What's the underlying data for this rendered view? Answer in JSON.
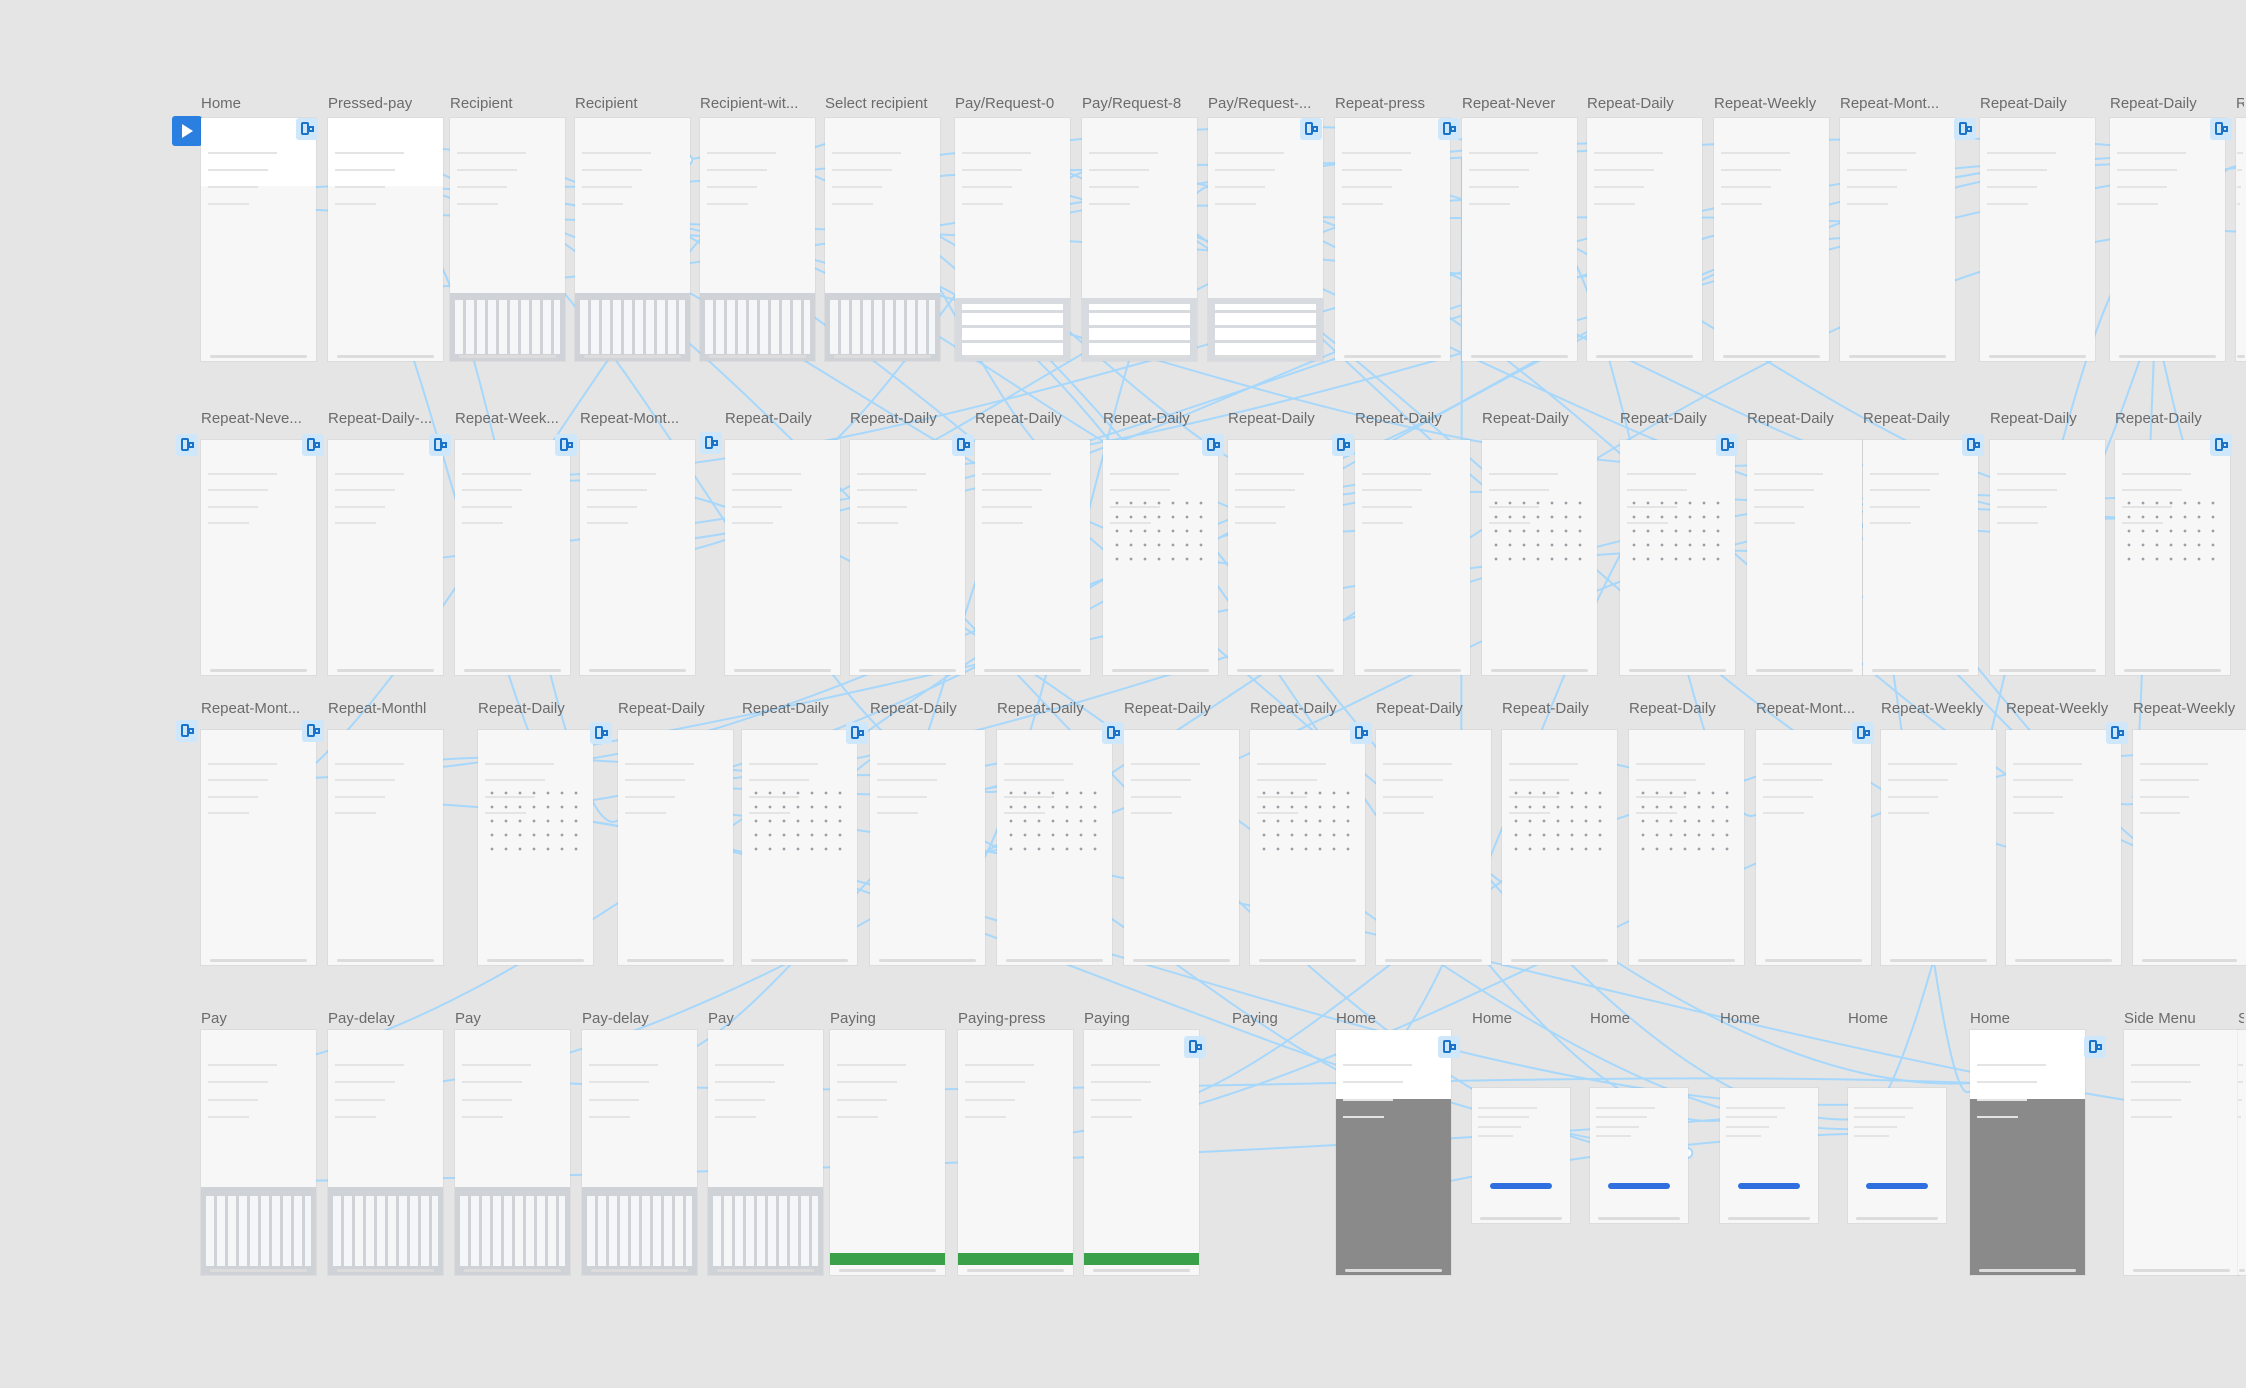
{
  "canvas": {
    "background": "#e5e5e5",
    "accent": "#2a7fe0",
    "wire_color": "#a7d8fb"
  },
  "rows": [
    {
      "frames": [
        {
          "label": "Home",
          "kind": "home"
        },
        {
          "label": "Pressed-pay",
          "kind": "home"
        },
        {
          "label": "Recipient",
          "kind": "list"
        },
        {
          "label": "Recipient",
          "kind": "list"
        },
        {
          "label": "Recipient-wit...",
          "kind": "list"
        },
        {
          "label": "Select recipient",
          "kind": "list"
        },
        {
          "label": "Pay/Request-0",
          "kind": "pad"
        },
        {
          "label": "Pay/Request-8",
          "kind": "pad"
        },
        {
          "label": "Pay/Request-...",
          "kind": "pad"
        },
        {
          "label": "Repeat-press",
          "kind": "plain"
        },
        {
          "label": "Repeat-Never",
          "kind": "plain"
        },
        {
          "label": "Repeat-Daily",
          "kind": "plain"
        },
        {
          "label": "Repeat-Weekly",
          "kind": "plain"
        },
        {
          "label": "Repeat-Mont...",
          "kind": "plain"
        },
        {
          "label": "Repeat-Daily",
          "kind": "plain"
        },
        {
          "label": "Repeat-Daily",
          "kind": "plain"
        },
        {
          "label": "R",
          "kind": "plain"
        }
      ]
    },
    {
      "frames": [
        {
          "label": "Repeat-Neve...",
          "kind": "plain"
        },
        {
          "label": "Repeat-Daily-...",
          "kind": "plain"
        },
        {
          "label": "Repeat-Week...",
          "kind": "plain"
        },
        {
          "label": "Repeat-Mont...",
          "kind": "plain"
        },
        {
          "label": "Repeat-Daily",
          "kind": "plain"
        },
        {
          "label": "Repeat-Daily",
          "kind": "plain"
        },
        {
          "label": "Repeat-Daily",
          "kind": "plain"
        },
        {
          "label": "Repeat-Daily",
          "kind": "cal"
        },
        {
          "label": "Repeat-Daily",
          "kind": "plain"
        },
        {
          "label": "Repeat-Daily",
          "kind": "plain"
        },
        {
          "label": "Repeat-Daily",
          "kind": "cal"
        },
        {
          "label": "Repeat-Daily",
          "kind": "cal"
        },
        {
          "label": "Repeat-Daily",
          "kind": "plain"
        },
        {
          "label": "Repeat-Daily",
          "kind": "plain"
        },
        {
          "label": "Repeat-Daily",
          "kind": "plain"
        },
        {
          "label": "Repeat-Daily",
          "kind": "cal"
        }
      ]
    },
    {
      "frames": [
        {
          "label": "Repeat-Mont...",
          "kind": "plain"
        },
        {
          "label": "Repeat-Monthl",
          "kind": "plain"
        },
        {
          "label": "Repeat-Daily",
          "kind": "cal"
        },
        {
          "label": "Repeat-Daily",
          "kind": "plain"
        },
        {
          "label": "Repeat-Daily",
          "kind": "cal"
        },
        {
          "label": "Repeat-Daily",
          "kind": "plain"
        },
        {
          "label": "Repeat-Daily",
          "kind": "cal"
        },
        {
          "label": "Repeat-Daily",
          "kind": "plain"
        },
        {
          "label": "Repeat-Daily",
          "kind": "cal"
        },
        {
          "label": "Repeat-Daily",
          "kind": "plain"
        },
        {
          "label": "Repeat-Daily",
          "kind": "cal"
        },
        {
          "label": "Repeat-Daily",
          "kind": "cal"
        },
        {
          "label": "Repeat-Mont...",
          "kind": "plain"
        },
        {
          "label": "Repeat-Weekly",
          "kind": "plain"
        },
        {
          "label": "Repeat-Weekly",
          "kind": "plain"
        },
        {
          "label": "Repeat-Weekly",
          "kind": "plain"
        }
      ]
    },
    {
      "frames": [
        {
          "label": "Pay",
          "kind": "kbd"
        },
        {
          "label": "Pay-delay",
          "kind": "kbd"
        },
        {
          "label": "Pay",
          "kind": "kbd"
        },
        {
          "label": "Pay-delay",
          "kind": "kbd"
        },
        {
          "label": "Pay",
          "kind": "kbd"
        },
        {
          "label": "Paying",
          "kind": "paying"
        },
        {
          "label": "Paying-press",
          "kind": "paying"
        },
        {
          "label": "Paying",
          "kind": "paying"
        },
        {
          "label": "Paying",
          "kind": "none"
        },
        {
          "label": "Home",
          "kind": "dark"
        },
        {
          "label": "Home",
          "kind": "card"
        },
        {
          "label": "Home",
          "kind": "card"
        },
        {
          "label": "Home",
          "kind": "card"
        },
        {
          "label": "Home",
          "kind": "card"
        },
        {
          "label": "Home",
          "kind": "dark"
        },
        {
          "label": "Side Menu",
          "kind": "menu"
        },
        {
          "label": "S",
          "kind": "plain"
        }
      ]
    }
  ]
}
